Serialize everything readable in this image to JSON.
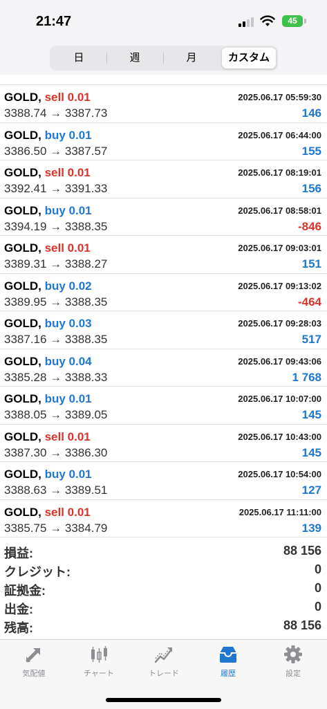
{
  "status": {
    "time": "21:47",
    "battery": "45"
  },
  "segments": [
    {
      "label": "日"
    },
    {
      "label": "週"
    },
    {
      "label": "月"
    },
    {
      "label": "カスタム"
    }
  ],
  "trades": [
    {
      "symbol": "GOLD,",
      "side": "sell",
      "volume": "0.01",
      "date": "2025.06.17 05:59:30",
      "prices": "3388.74 → 3387.73",
      "profit": "146"
    },
    {
      "symbol": "GOLD,",
      "side": "buy",
      "volume": "0.01",
      "date": "2025.06.17 06:44:00",
      "prices": "3386.50 → 3387.57",
      "profit": "155"
    },
    {
      "symbol": "GOLD,",
      "side": "sell",
      "volume": "0.01",
      "date": "2025.06.17 08:19:01",
      "prices": "3392.41 → 3391.33",
      "profit": "156"
    },
    {
      "symbol": "GOLD,",
      "side": "buy",
      "volume": "0.01",
      "date": "2025.06.17 08:58:01",
      "prices": "3394.19 → 3388.35",
      "profit": "-846"
    },
    {
      "symbol": "GOLD,",
      "side": "sell",
      "volume": "0.01",
      "date": "2025.06.17 09:03:01",
      "prices": "3389.31 → 3388.27",
      "profit": "151"
    },
    {
      "symbol": "GOLD,",
      "side": "buy",
      "volume": "0.02",
      "date": "2025.06.17 09:13:02",
      "prices": "3389.95 → 3388.35",
      "profit": "-464"
    },
    {
      "symbol": "GOLD,",
      "side": "buy",
      "volume": "0.03",
      "date": "2025.06.17 09:28:03",
      "prices": "3387.16 → 3388.35",
      "profit": "517"
    },
    {
      "symbol": "GOLD,",
      "side": "buy",
      "volume": "0.04",
      "date": "2025.06.17 09:43:06",
      "prices": "3385.28 → 3388.33",
      "profit": "1 768"
    },
    {
      "symbol": "GOLD,",
      "side": "buy",
      "volume": "0.01",
      "date": "2025.06.17 10:07:00",
      "prices": "3388.05 → 3389.05",
      "profit": "145"
    },
    {
      "symbol": "GOLD,",
      "side": "sell",
      "volume": "0.01",
      "date": "2025.06.17 10:43:00",
      "prices": "3387.30 → 3386.30",
      "profit": "145"
    },
    {
      "symbol": "GOLD,",
      "side": "buy",
      "volume": "0.01",
      "date": "2025.06.17 10:54:00",
      "prices": "3388.63 → 3389.51",
      "profit": "127"
    },
    {
      "symbol": "GOLD,",
      "side": "sell",
      "volume": "0.01",
      "date": "2025.06.17 11:11:00",
      "prices": "3385.75 → 3384.79",
      "profit": "139"
    }
  ],
  "summary": [
    {
      "label": "損益:",
      "value": "88 156"
    },
    {
      "label": "クレジット:",
      "value": "0"
    },
    {
      "label": "証拠金:",
      "value": "0"
    },
    {
      "label": "出金:",
      "value": "0"
    },
    {
      "label": "残高:",
      "value": "88 156"
    }
  ],
  "tabs": [
    {
      "label": "気配値",
      "icon": "quotes-icon"
    },
    {
      "label": "チャート",
      "icon": "chart-icon"
    },
    {
      "label": "トレード",
      "icon": "trade-icon"
    },
    {
      "label": "履歴",
      "icon": "history-icon"
    },
    {
      "label": "設定",
      "icon": "settings-icon"
    }
  ],
  "colors": {
    "buy": "#1f77d0",
    "sell": "#d9332b",
    "accent": "#1f77d0"
  }
}
